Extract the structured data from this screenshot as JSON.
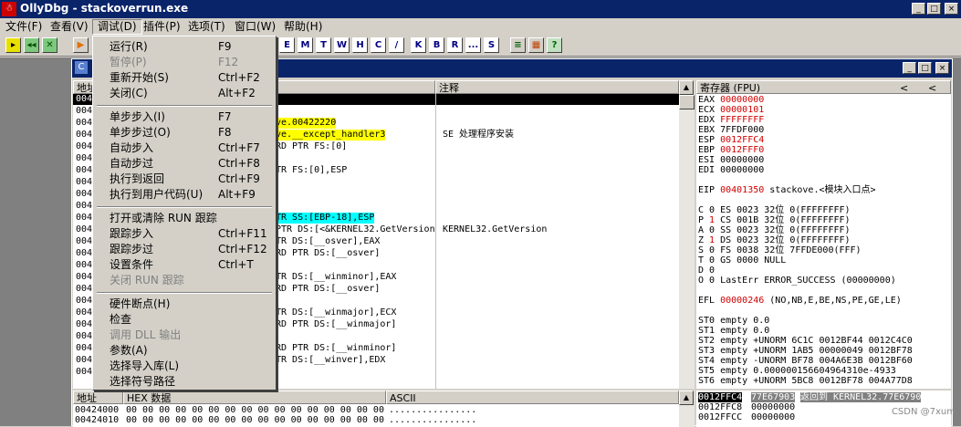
{
  "app": {
    "title": "OllyDbg - stackoverrun.exe",
    "icon_glyph": "☃",
    "min_glyph": "_",
    "max_glyph": "□",
    "close_glyph": "×"
  },
  "menubar": [
    {
      "label": "文件(F)"
    },
    {
      "label": "查看(V)"
    },
    {
      "label": "调试(D)"
    },
    {
      "label": "插件(P)"
    },
    {
      "label": "选项(T)"
    },
    {
      "label": "窗口(W)"
    },
    {
      "label": "帮助(H)"
    }
  ],
  "toolbar": {
    "left_icons": [
      "open-icon",
      "restart-icon",
      "close-icon",
      "run-icon"
    ],
    "letters": [
      "E",
      "M",
      "T",
      "W",
      "H",
      "C",
      "/",
      "K",
      "B",
      "R",
      "...",
      "S"
    ],
    "right_icons": [
      "list-icon",
      "grid-icon",
      "help-icon"
    ]
  },
  "debug_menu": {
    "groups": [
      [
        {
          "label": "运行(R)",
          "shortcut": "F9",
          "enabled": true
        },
        {
          "label": "暂停(P)",
          "shortcut": "F12",
          "enabled": false
        },
        {
          "label": "重新开始(S)",
          "shortcut": "Ctrl+F2",
          "enabled": true
        },
        {
          "label": "关闭(C)",
          "shortcut": "Alt+F2",
          "enabled": true
        }
      ],
      [
        {
          "label": "单步步入(I)",
          "shortcut": "F7",
          "enabled": true
        },
        {
          "label": "单步步过(O)",
          "shortcut": "F8",
          "enabled": true
        },
        {
          "label": "自动步入",
          "shortcut": "Ctrl+F7",
          "enabled": true
        },
        {
          "label": "自动步过",
          "shortcut": "Ctrl+F8",
          "enabled": true
        },
        {
          "label": "执行到返回",
          "shortcut": "Ctrl+F9",
          "enabled": true
        },
        {
          "label": "执行到用户代码(U)",
          "shortcut": "Alt+F9",
          "enabled": true
        }
      ],
      [
        {
          "label": "打开或清除 RUN 跟踪",
          "shortcut": "",
          "enabled": true
        },
        {
          "label": "跟踪步入",
          "shortcut": "Ctrl+F11",
          "enabled": true
        },
        {
          "label": "跟踪步过",
          "shortcut": "Ctrl+F12",
          "enabled": true
        },
        {
          "label": "设置条件",
          "shortcut": "Ctrl+T",
          "enabled": true
        },
        {
          "label": "关闭 RUN 跟踪",
          "shortcut": "",
          "enabled": false
        }
      ],
      [
        {
          "label": "硬件断点(H)",
          "shortcut": "",
          "enabled": true
        },
        {
          "label": "检查",
          "shortcut": "",
          "enabled": true
        },
        {
          "label": "调用 DLL 输出",
          "shortcut": "",
          "enabled": false
        },
        {
          "label": "参数(A)",
          "shortcut": "",
          "enabled": true
        },
        {
          "label": "选择导入库(L)",
          "shortcut": "",
          "enabled": true
        },
        {
          "label": "选择符号路径",
          "shortcut": "",
          "enabled": true
        }
      ]
    ]
  },
  "cpu_window": {
    "icon_label": "C",
    "disasm": {
      "header_addr": "地址",
      "header_comment": "注释",
      "rows": [
        {
          "addr": "004",
          "code": "",
          "comment": "",
          "hl": "sel"
        },
        {
          "addr": "004",
          "code": "",
          "comment": "",
          "hl": ""
        },
        {
          "addr": "004",
          "code": "ve.00422220",
          "comment": "",
          "hl": "yellow"
        },
        {
          "addr": "004",
          "code": "ve.__except_handler3",
          "comment": "SE 处理程序安装",
          "hl": "yellow"
        },
        {
          "addr": "004",
          "code": "RD PTR FS:[0]",
          "comment": "",
          "hl": ""
        },
        {
          "addr": "004",
          "code": "",
          "comment": "",
          "hl": ""
        },
        {
          "addr": "004",
          "code": "TR FS:[0],ESP",
          "comment": "",
          "hl": ""
        },
        {
          "addr": "004",
          "code": "",
          "comment": "",
          "hl": ""
        },
        {
          "addr": "004",
          "code": "",
          "comment": "",
          "hl": ""
        },
        {
          "addr": "004",
          "code": "",
          "comment": "",
          "hl": ""
        },
        {
          "addr": "004",
          "code": "TR SS:[EBP-18],ESP",
          "comment": "",
          "hl": "cyan"
        },
        {
          "addr": "004",
          "code": "PTR DS:[<&KERNEL32.GetVersion",
          "comment": "KERNEL32.GetVersion",
          "hl": ""
        },
        {
          "addr": "004",
          "code": "TR DS:[__osver],EAX",
          "comment": "",
          "hl": ""
        },
        {
          "addr": "004",
          "code": "RD PTR DS:[__osver]",
          "comment": "",
          "hl": ""
        },
        {
          "addr": "004",
          "code": "",
          "comment": "",
          "hl": ""
        },
        {
          "addr": "004",
          "code": "TR DS:[__winminor],EAX",
          "comment": "",
          "hl": ""
        },
        {
          "addr": "004",
          "code": "RD PTR DS:[__osver]",
          "comment": "",
          "hl": ""
        },
        {
          "addr": "004",
          "code": "",
          "comment": "",
          "hl": ""
        },
        {
          "addr": "004",
          "code": "TR DS:[__winmajor],ECX",
          "comment": "",
          "hl": ""
        },
        {
          "addr": "004",
          "code": "RD PTR DS:[__winmajor]",
          "comment": "",
          "hl": ""
        },
        {
          "addr": "004",
          "code": "",
          "comment": "",
          "hl": ""
        },
        {
          "addr": "004",
          "code": "RD PTR DS:[__winminor]",
          "comment": "",
          "hl": ""
        },
        {
          "addr": "004",
          "code": "TR DS:[__winver],EDX",
          "comment": "",
          "hl": ""
        },
        {
          "addr": "004",
          "code": "",
          "comment": "",
          "hl": ""
        }
      ]
    },
    "registers": {
      "header": "寄存器 (FPU)",
      "nav_left": "<",
      "nav_right": "<",
      "lines": [
        {
          "text": "EAX ",
          "val": "00000000",
          "rest": "",
          "red": true
        },
        {
          "text": "ECX ",
          "val": "00000101",
          "rest": "",
          "red": true
        },
        {
          "text": "EDX ",
          "val": "FFFFFFFF",
          "rest": "",
          "red": true
        },
        {
          "text": "EBX ",
          "val": "7FFDF000",
          "rest": "",
          "red": false
        },
        {
          "text": "ESP ",
          "val": "0012FFC4",
          "rest": "",
          "red": true
        },
        {
          "text": "EBP ",
          "val": "0012FFF0",
          "rest": "",
          "red": true
        },
        {
          "text": "ESI ",
          "val": "00000000",
          "rest": "",
          "red": false
        },
        {
          "text": "EDI ",
          "val": "00000000",
          "rest": "",
          "red": false
        },
        {
          "text": "",
          "val": "",
          "rest": "",
          "red": false
        },
        {
          "text": "EIP ",
          "val": "00401350",
          "rest": " stackove.<模块入口点>",
          "red": true
        },
        {
          "text": "",
          "val": "",
          "rest": "",
          "red": false
        },
        {
          "text": "C 0  ES 0023 32位 0(FFFFFFFF)",
          "val": "",
          "rest": "",
          "red": false
        },
        {
          "text": "P ",
          "val": "1",
          "rest": "  CS 001B 32位 0(FFFFFFFF)",
          "red": true
        },
        {
          "text": "A 0  SS 0023 32位 0(FFFFFFFF)",
          "val": "",
          "rest": "",
          "red": false
        },
        {
          "text": "Z ",
          "val": "1",
          "rest": "  DS 0023 32位 0(FFFFFFFF)",
          "red": true
        },
        {
          "text": "S 0  FS 0038 32位 7FFDE000(FFF)",
          "val": "",
          "rest": "",
          "red": false
        },
        {
          "text": "T 0  GS 0000 NULL",
          "val": "",
          "rest": "",
          "red": false
        },
        {
          "text": "D 0",
          "val": "",
          "rest": "",
          "red": false
        },
        {
          "text": "O 0  LastErr ERROR_SUCCESS (00000000)",
          "val": "",
          "rest": "",
          "red": false
        },
        {
          "text": "",
          "val": "",
          "rest": "",
          "red": false
        },
        {
          "text": "EFL ",
          "val": "00000246",
          "rest": " (NO,NB,E,BE,NS,PE,GE,LE)",
          "red": true
        },
        {
          "text": "",
          "val": "",
          "rest": "",
          "red": false
        },
        {
          "text": "ST0 empty 0.0",
          "val": "",
          "rest": "",
          "red": false
        },
        {
          "text": "ST1 empty 0.0",
          "val": "",
          "rest": "",
          "red": false
        },
        {
          "text": "ST2 empty +UNORM 6C1C 0012BF44 0012C4C0",
          "val": "",
          "rest": "",
          "red": false
        },
        {
          "text": "ST3 empty +UNORM 1AB5 00000049 0012BF78",
          "val": "",
          "rest": "",
          "red": false
        },
        {
          "text": "ST4 empty -UNORM BF78 004A6E3B 0012BF60",
          "val": "",
          "rest": "",
          "red": false
        },
        {
          "text": "ST5 empty 0.000000156604964310e-4933",
          "val": "",
          "rest": "",
          "red": false
        },
        {
          "text": "ST6 empty +UNORM 5BC8 0012BF78 004A77D8",
          "val": "",
          "rest": "",
          "red": false
        }
      ]
    },
    "dump": {
      "header_addr": "地址",
      "header_hex": "HEX 数据",
      "header_ascii": "ASCII",
      "rows": [
        {
          "addr": "00424000",
          "hex": "00 00 00 00 00 00 00 00 00 00 00 00 00 00 00 00",
          "ascii": "................"
        },
        {
          "addr": "00424010",
          "hex": "00 00 00 00 00 00 00 00 00 00 00 00 00 00 00 00",
          "ascii": "................"
        }
      ]
    },
    "stack": {
      "rows": [
        {
          "addr": "0012FFC4",
          "val": "77E67903",
          "comment": "返回到 KERNEL32.77E6790",
          "sel": true
        },
        {
          "addr": "0012FFC8",
          "val": "00000000",
          "comment": "",
          "sel": false
        },
        {
          "addr": "0012FFCC",
          "val": "00000000",
          "comment": "",
          "sel": false
        }
      ]
    }
  },
  "watermark": "CSDN @7xum"
}
